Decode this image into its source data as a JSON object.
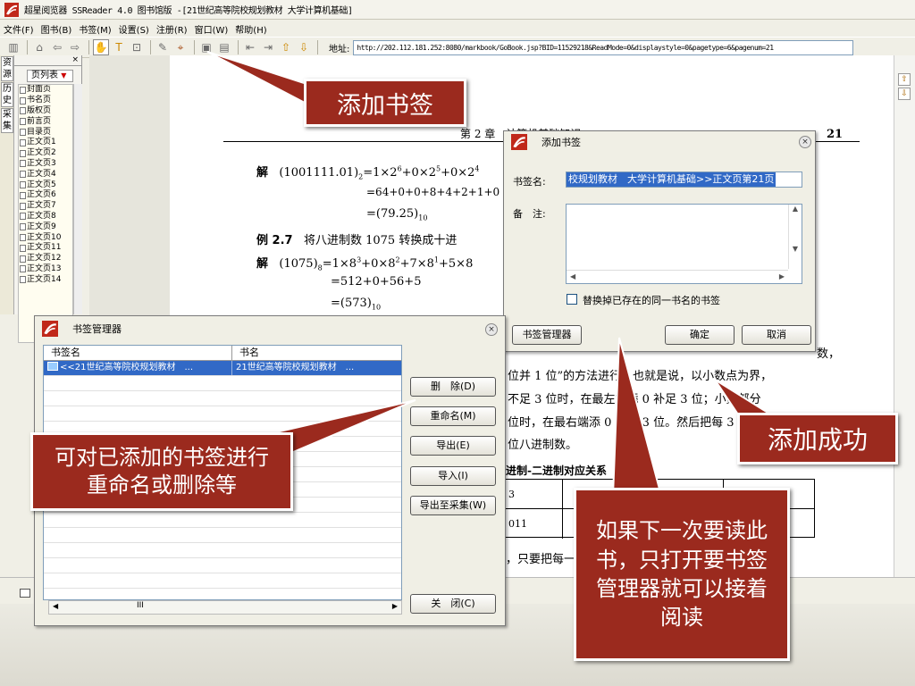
{
  "window": {
    "title": "超星阅览器 SSReader 4.0 图书馆版 -[21世纪高等院校规划教材  大学计算机基础]"
  },
  "menu": [
    "文件(F)",
    "图书(B)",
    "书签(M)",
    "设置(S)",
    "注册(R)",
    "窗口(W)",
    "帮助(H)"
  ],
  "toolbar": {
    "addr_label": "地址:",
    "addr_value": "http://202.112.181.252:8080/markbook/GoBook.jsp?BID=11529218&ReadMode=0&displaystyle=0&pagetype=6&pagenum=21"
  },
  "left_tabs": [
    "资",
    "源",
    "历",
    "史",
    "采",
    "集"
  ],
  "panel": {
    "tab": "页列表",
    "close": "×",
    "pages": [
      "封面页",
      "书名页",
      "版权页",
      "前言页",
      "目录页",
      "正文页1",
      "正文页2",
      "正文页3",
      "正文页4",
      "正文页5",
      "正文页6",
      "正文页7",
      "正文页8",
      "正文页9",
      "正文页10",
      "正文页11",
      "正文页12",
      "正文页13",
      "正文页14"
    ]
  },
  "book": {
    "header": "第 2 章　计算机基础知识",
    "page_num": "21",
    "l1a": "解",
    "l1b": "(1001111.01)",
    "l1c": "2",
    "l1d": "=1×2",
    "l1e": "6",
    "l1f": "+0×2",
    "l1g": "5",
    "l1h": "+0×2",
    "l1i": "4",
    "l2": "=64+0+0+8+4+2+1+0",
    "l3a": "=(79.25)",
    "l3b": "10",
    "l4a": "例 2.7",
    "l4b": "将八进制数 1075 转换成十进",
    "l5a": "解",
    "l5b": "(1075)",
    "l5c": "8",
    "l5d": "=1×8",
    "l5e": "3",
    "l5f": "+0×8",
    "l5g": "2",
    "l5h": "+7×8",
    "l5i": "1",
    "l5j": "+5×8",
    "l6": "=512+0+56+5",
    "l7a": "=(573)",
    "l7b": "10",
    "r1": "数，",
    "r2": "位并 1 位”的方法进行。也就是说，以小数点为界，",
    "r3": "不足 3 位时，在最左端添 0 补足 3 位；小数部分",
    "r4": "位时，在最右端添 0 补足 3 位。然后把每 3 位二",
    "r5": "位八进制数。",
    "r6": "进制-二进制对应关系",
    "t1": "3",
    "t2": "011",
    "r7": "，只要把每一位八进制数展开"
  },
  "add_dialog": {
    "title": "添加书签",
    "name_label": "书签名:",
    "name_value": "校规划教材　大学计算机基础>>正文页第21页",
    "note_label": "备　注:",
    "checkbox_label": "替换掉已存在的同一书名的书签",
    "manager_btn": "书签管理器",
    "ok_btn": "确定",
    "cancel_btn": "取消",
    "close": "×"
  },
  "manager": {
    "title": "书签管理器",
    "col1": "书签名",
    "col2": "书名",
    "row_name": "<<21世纪高等院校规划教材　...",
    "row_book": "21世纪高等院校规划教材　...",
    "delete_btn": "删　除(D)",
    "rename_btn": "重命名(M)",
    "export_btn": "导出(E)",
    "import_btn": "导入(I)",
    "export_collect_btn": "导出至采集(W)",
    "close_btn": "关　闭(C)",
    "close": "×",
    "hscroll_thumb": "III"
  },
  "callouts": {
    "add_bookmark": "添加书签",
    "added": "添加成功",
    "rename": "可对已添加的书签进行重命名或删除等",
    "next_time": "如果下一次要读此书，只打开要书签管理器就可以接着阅读"
  },
  "colors": {
    "callout": "#9b2a1e",
    "selection": "#3169c6"
  }
}
